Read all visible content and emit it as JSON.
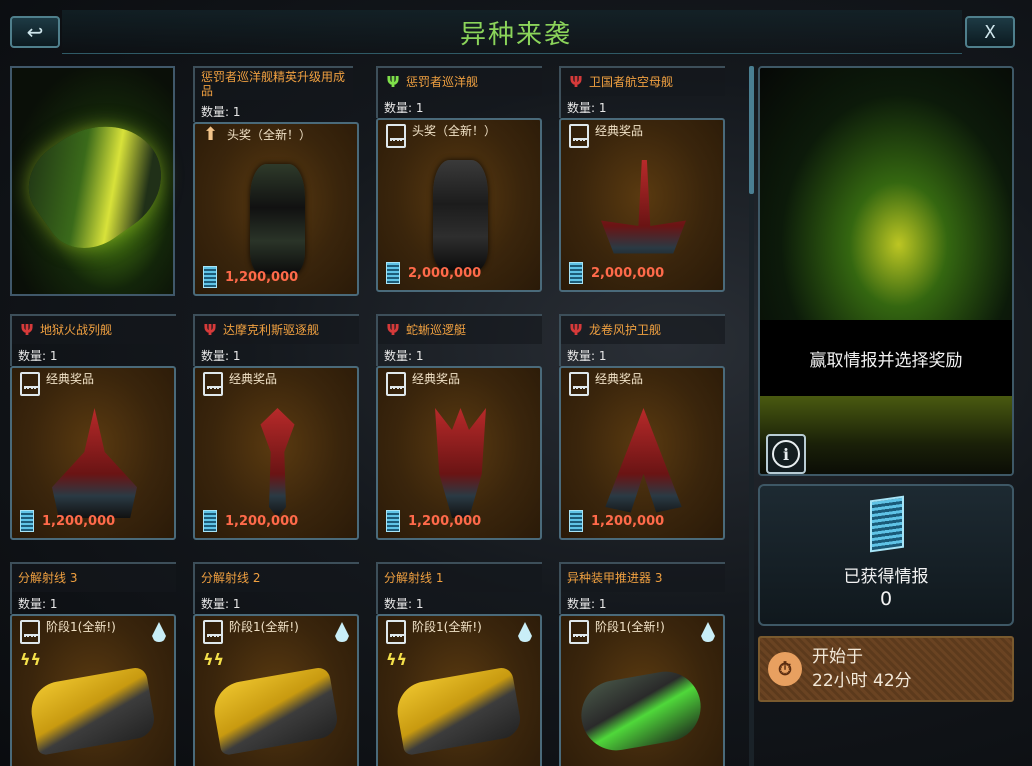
{
  "header": {
    "title": "异种来袭",
    "back_icon": "↩",
    "close_label": "X"
  },
  "cards": [
    {
      "title": "惩罚者巡洋舰精英升级用成品",
      "faction": "none",
      "quantity": "数量: 1",
      "tag_icon": "up-arrow-icon",
      "tag_label": "头奖（全新！）",
      "price": "1,200,000",
      "art": "dark-cruiser-ship"
    },
    {
      "title": "惩罚者巡洋舰",
      "faction": "green",
      "quantity": "数量: 1",
      "tag_icon": "card-icon",
      "tag_label": "头奖（全新！）",
      "price": "2,000,000",
      "art": "gray-cruiser-ship"
    },
    {
      "title": "卫国者航空母舰",
      "faction": "red",
      "quantity": "数量: 1",
      "tag_icon": "card-icon",
      "tag_label": "经典奖品",
      "price": "2,000,000",
      "art": "red-carrier-ship"
    },
    {
      "title": "地狱火战列舰",
      "faction": "red",
      "quantity": "数量: 1",
      "tag_icon": "card-icon",
      "tag_label": "经典奖品",
      "price": "1,200,000",
      "art": "red-battleship"
    },
    {
      "title": "达摩克利斯驱逐舰",
      "faction": "red",
      "quantity": "数量: 1",
      "tag_icon": "card-icon",
      "tag_label": "经典奖品",
      "price": "1,200,000",
      "art": "red-destroyer-ship"
    },
    {
      "title": "蛇蜥巡逻艇",
      "faction": "red",
      "quantity": "数量: 1",
      "tag_icon": "card-icon",
      "tag_label": "经典奖品",
      "price": "1,200,000",
      "art": "red-patrol-ship"
    },
    {
      "title": "龙卷风护卫舰",
      "faction": "red",
      "quantity": "数量: 1",
      "tag_icon": "card-icon",
      "tag_label": "经典奖品",
      "price": "1,200,000",
      "art": "red-frigate-ship"
    },
    {
      "title": "分解射线 3",
      "faction": "none",
      "quantity": "数量: 1",
      "tag_icon": "card-icon",
      "tag_label": "阶段1(全新!)",
      "art": "yellow-beam-weapon"
    },
    {
      "title": "分解射线 2",
      "faction": "none",
      "quantity": "数量: 1",
      "tag_icon": "card-icon",
      "tag_label": "阶段1(全新!)",
      "art": "yellow-beam-weapon"
    },
    {
      "title": "分解射线 1",
      "faction": "none",
      "quantity": "数量: 1",
      "tag_icon": "card-icon",
      "tag_label": "阶段1(全新!)",
      "art": "yellow-beam-weapon"
    },
    {
      "title": "异种装甲推进器 3",
      "faction": "none",
      "quantity": "数量: 1",
      "tag_icon": "card-icon",
      "tag_label": "阶段1(全新!)",
      "art": "green-armor-thruster"
    }
  ],
  "icons": {
    "faction_red": "Ψ",
    "faction_green": "Ψ",
    "up_arrow": "⬆",
    "bolt": "ϟϟ"
  },
  "right_panel": {
    "intel_banner": "赢取情报并选择奖励",
    "info_icon": "i",
    "gained_label": "已获得情报",
    "gained_count": "0",
    "timer_label": "开始于",
    "timer_value": "22小时 42分",
    "timer_icon": "⏱"
  },
  "colors": {
    "title_green": "#8bd45a",
    "card_title_orange": "#f0a040",
    "price_red": "#ff6a4a"
  }
}
